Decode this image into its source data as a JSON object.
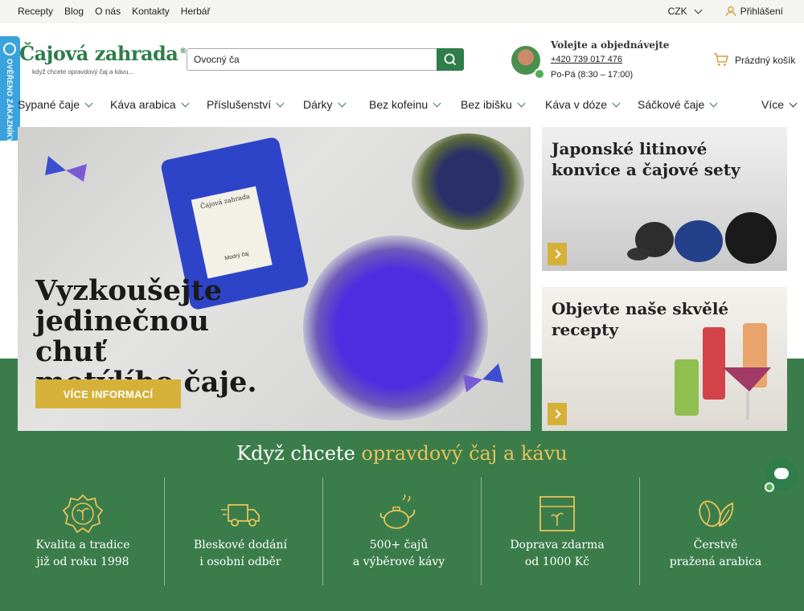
{
  "topbar": {
    "links": [
      "Recepty",
      "Blog",
      "O nás",
      "Kontakty",
      "Herbář"
    ],
    "currency": "CZK",
    "login": "Přihlášení"
  },
  "badge": {
    "text": "OVĚŘENO ZÁKAZNÍKY"
  },
  "logo": {
    "name": "Čajová zahrada",
    "tagline": "když chcete opravdový čaj a kávu..."
  },
  "search": {
    "value": "Ovocný ča"
  },
  "contact": {
    "title": "Volejte a objednávejte",
    "phone": "+420 739 017 476",
    "hours": "Po-Pá (8:30 – 17:00)"
  },
  "cart": {
    "label": "Prázdný košík"
  },
  "menu": [
    "Sypané čaje",
    "Káva arabica",
    "Příslušenství",
    "Dárky",
    "Bez kofeinu",
    "Bez ibišku",
    "Káva v dóze",
    "Sáčkové čaje",
    "Více"
  ],
  "hero": {
    "line1": "Vyzkoušejte",
    "line2": "jedinečnou chuť",
    "line3": "motýlího čaje.",
    "cta": "VÍCE INFORMACÍ",
    "pouch_brand": "Čajová zahrada",
    "pouch_name": "Modrý čaj"
  },
  "promos": [
    {
      "title": "Japonské litinové konvice a čajové sety"
    },
    {
      "title": "Objevte naše skvělé recepty"
    }
  ],
  "slogan": {
    "pre": "Když chcete ",
    "accent": "opravdový čaj a kávu"
  },
  "features": [
    {
      "l1": "Kvalita a tradice",
      "l2": "již od roku 1998",
      "icon": "quality-badge-icon"
    },
    {
      "l1": "Bleskové dodání",
      "l2": "i osobní odběr",
      "icon": "delivery-truck-icon"
    },
    {
      "l1": "500+ čajů",
      "l2": "a výběrové kávy",
      "icon": "teapot-icon"
    },
    {
      "l1": "Doprava zdarma",
      "l2": "od 1000 Kč",
      "icon": "package-icon"
    },
    {
      "l1": "Čerstvě",
      "l2": "pražená arabica",
      "icon": "coffee-bean-icon"
    }
  ],
  "colors": {
    "brand_green": "#2e7d4a",
    "gold": "#d6b13a",
    "band_green": "#3b7d4a",
    "badge_blue": "#3aa3dd"
  }
}
